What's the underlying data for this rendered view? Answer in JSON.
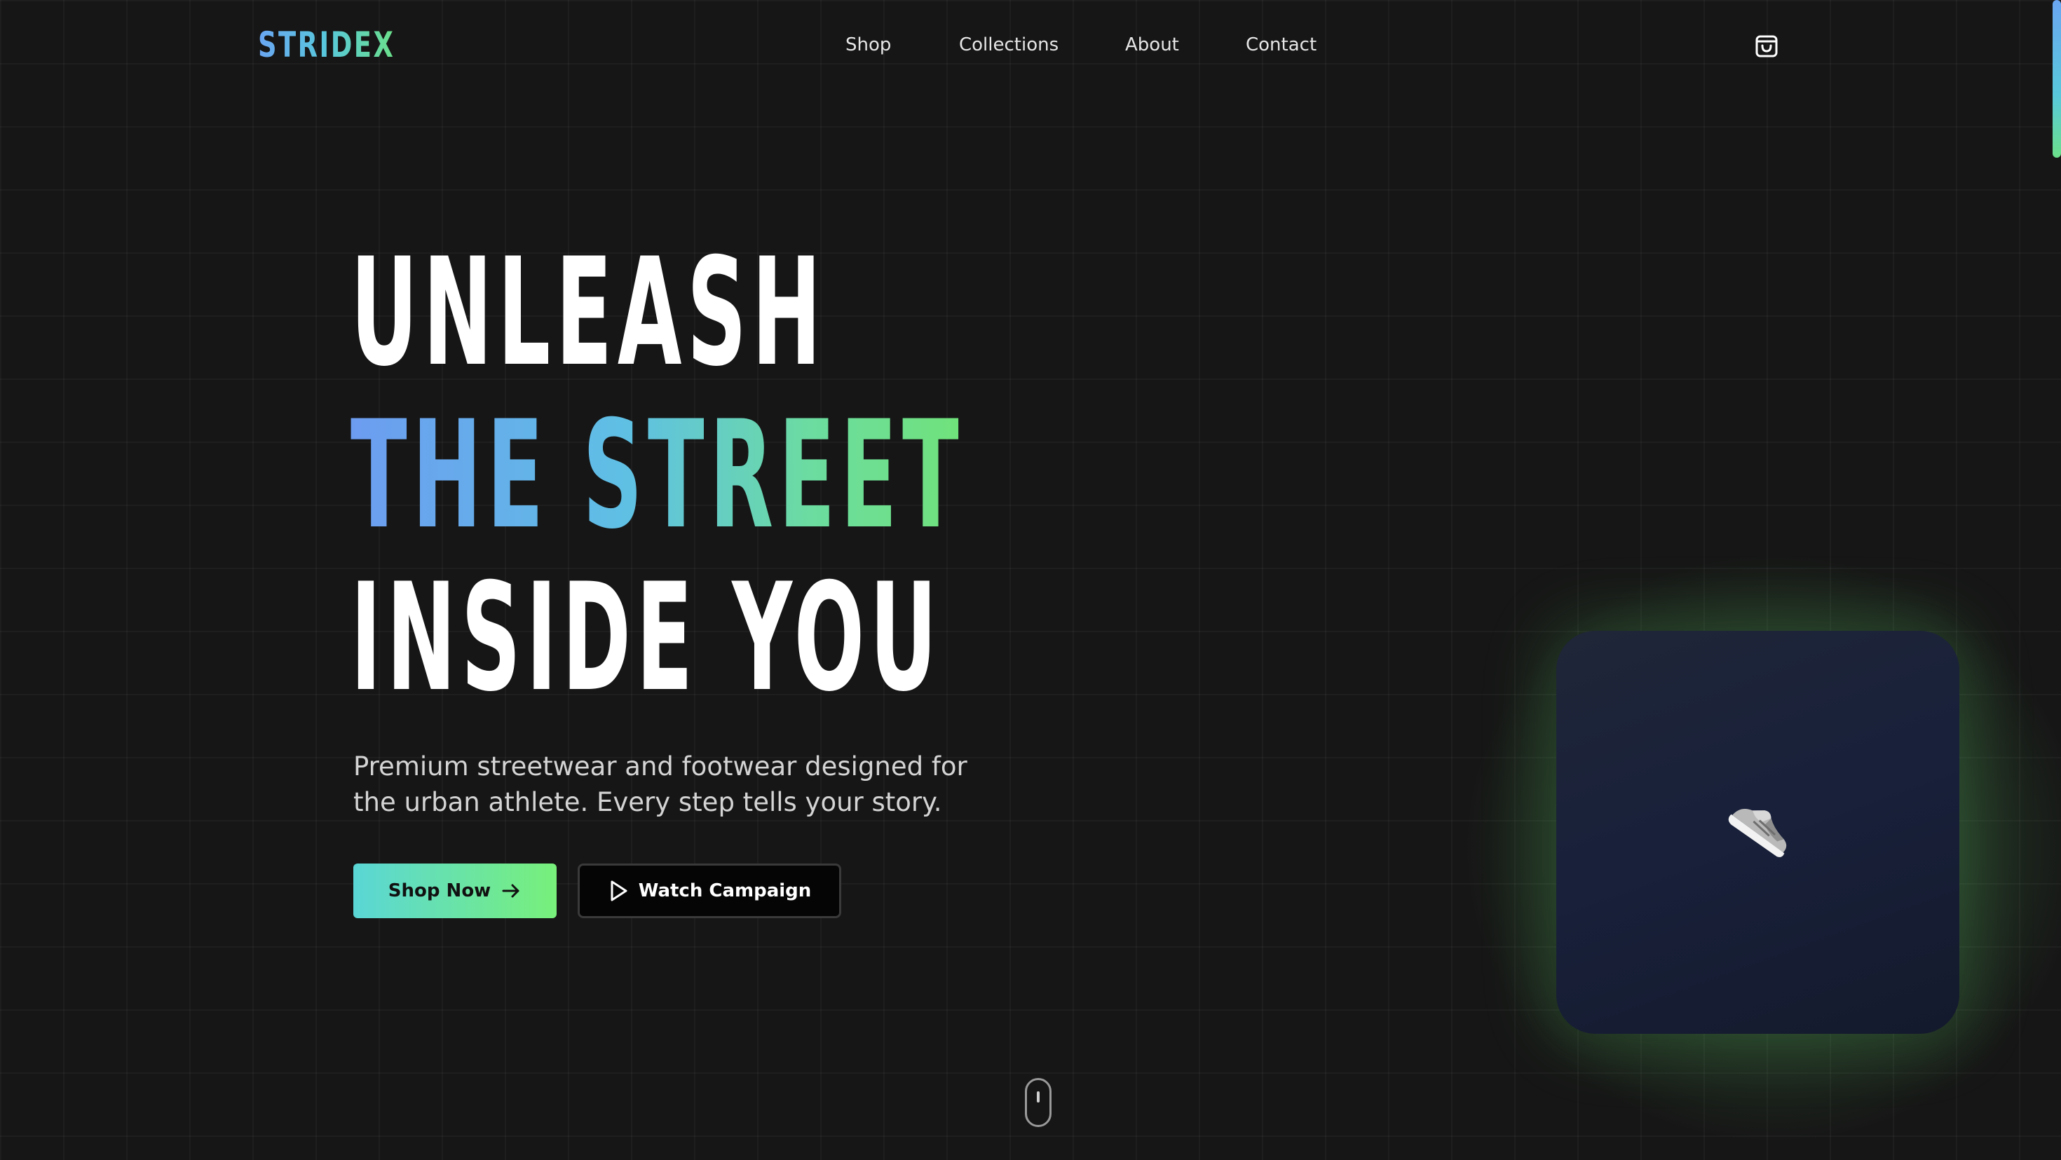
{
  "brand": {
    "logo": "STRIDEX"
  },
  "nav": {
    "items": [
      "Shop",
      "Collections",
      "About",
      "Contact"
    ]
  },
  "header": {
    "cart_icon": "shopping-bag-icon"
  },
  "hero": {
    "line1": "UNLEASH",
    "line2": "THE STREET",
    "line3": "INSIDE YOU",
    "subtitle": "Premium streetwear and footwear designed for the urban athlete. Every step tells your story.",
    "primary_cta": "Shop Now",
    "primary_cta_icon": "arrow-right-icon",
    "secondary_cta": "Watch Campaign",
    "secondary_cta_icon": "play-icon"
  },
  "product_card": {
    "image_icon": "sneaker-icon"
  },
  "scroll_indicator": {
    "icon": "mouse-scroll-icon"
  },
  "colors": {
    "background": "#161616",
    "accent_blue": "#6aa6f2",
    "accent_cyan": "#58c8dc",
    "accent_green": "#6be08a",
    "card": "#1b2236"
  }
}
